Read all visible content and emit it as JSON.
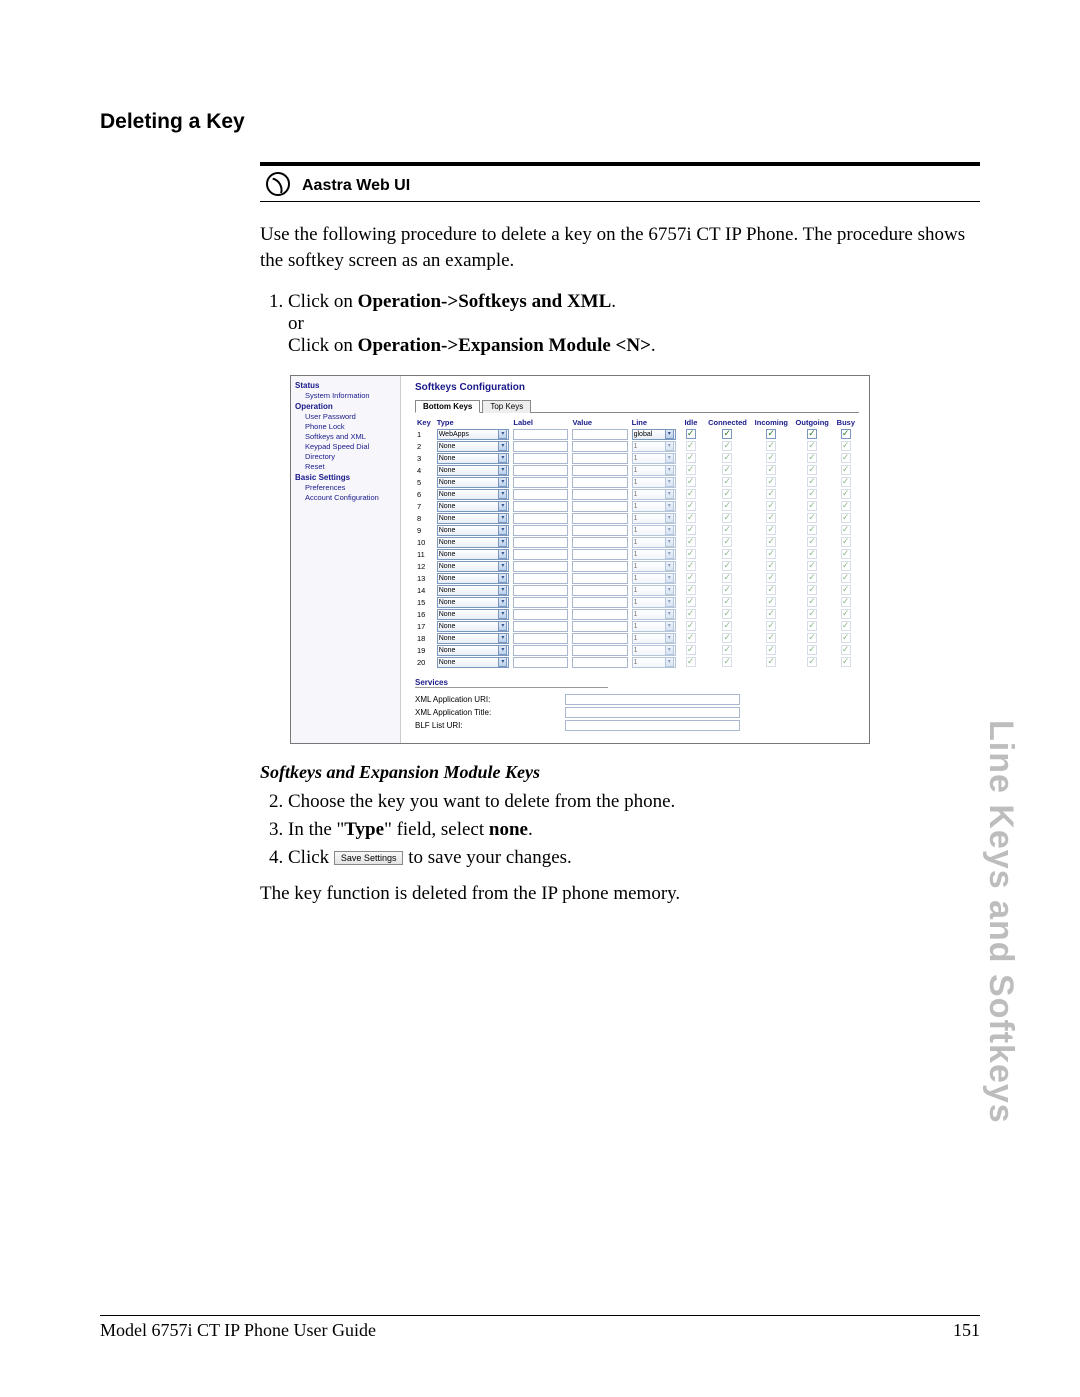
{
  "page": {
    "section_title": "Deleting a Key",
    "web_ui_label": "Aastra Web UI",
    "intro": "Use the following procedure to delete a key on the 6757i CT IP Phone. The procedure shows the softkey screen as an example.",
    "step1_a": "Click on ",
    "step1_b": "Operation->Softkeys and XML",
    "step1_c": ".",
    "step1_or": "or",
    "step1_d": "Click on ",
    "step1_e": "Operation->Expansion Module <N>",
    "step1_f": ".",
    "sub_heading": "Softkeys and Expansion Module Keys",
    "step2": "Choose the key you want to delete from the phone.",
    "step3_a": "In the \"",
    "step3_b": "Type",
    "step3_c": "\" field, select ",
    "step3_d": "none",
    "step3_e": ".",
    "step4_a": "Click ",
    "step4_btn": "Save Settings",
    "step4_b": " to save your changes.",
    "closing": "The key function is deleted from the IP phone memory.",
    "side_tab": "Line Keys and Softkeys",
    "footer_left": "Model 6757i CT IP Phone User Guide",
    "footer_right": "151"
  },
  "screenshot": {
    "nav": {
      "status": "Status",
      "status_items": [
        "System Information"
      ],
      "operation": "Operation",
      "operation_items": [
        "User Password",
        "Phone Lock",
        "Softkeys and XML",
        "Keypad Speed Dial",
        "Directory",
        "Reset"
      ],
      "basic": "Basic Settings",
      "basic_items": [
        "Preferences",
        "Account Configuration"
      ]
    },
    "title": "Softkeys Configuration",
    "tabs": {
      "bottom": "Bottom Keys",
      "top": "Top Keys"
    },
    "headers": {
      "key": "Key",
      "type": "Type",
      "label": "Label",
      "value": "Value",
      "line": "Line",
      "idle": "Idle",
      "connected": "Connected",
      "incoming": "Incoming",
      "outgoing": "Outgoing",
      "busy": "Busy"
    },
    "rows": [
      {
        "key": "1",
        "type": "WebApps",
        "line": "global",
        "enabled": true
      },
      {
        "key": "2",
        "type": "None",
        "line": "1",
        "enabled": false
      },
      {
        "key": "3",
        "type": "None",
        "line": "1",
        "enabled": false
      },
      {
        "key": "4",
        "type": "None",
        "line": "1",
        "enabled": false
      },
      {
        "key": "5",
        "type": "None",
        "line": "1",
        "enabled": false
      },
      {
        "key": "6",
        "type": "None",
        "line": "1",
        "enabled": false
      },
      {
        "key": "7",
        "type": "None",
        "line": "1",
        "enabled": false
      },
      {
        "key": "8",
        "type": "None",
        "line": "1",
        "enabled": false
      },
      {
        "key": "9",
        "type": "None",
        "line": "1",
        "enabled": false
      },
      {
        "key": "10",
        "type": "None",
        "line": "1",
        "enabled": false
      },
      {
        "key": "11",
        "type": "None",
        "line": "1",
        "enabled": false
      },
      {
        "key": "12",
        "type": "None",
        "line": "1",
        "enabled": false
      },
      {
        "key": "13",
        "type": "None",
        "line": "1",
        "enabled": false
      },
      {
        "key": "14",
        "type": "None",
        "line": "1",
        "enabled": false
      },
      {
        "key": "15",
        "type": "None",
        "line": "1",
        "enabled": false
      },
      {
        "key": "16",
        "type": "None",
        "line": "1",
        "enabled": false
      },
      {
        "key": "17",
        "type": "None",
        "line": "1",
        "enabled": false
      },
      {
        "key": "18",
        "type": "None",
        "line": "1",
        "enabled": false
      },
      {
        "key": "19",
        "type": "None",
        "line": "1",
        "enabled": false
      },
      {
        "key": "20",
        "type": "None",
        "line": "1",
        "enabled": false
      }
    ],
    "services": {
      "heading": "Services",
      "xml_uri": "XML Application URI:",
      "xml_title": "XML Application Title:",
      "blf_uri": "BLF List URI:"
    }
  }
}
